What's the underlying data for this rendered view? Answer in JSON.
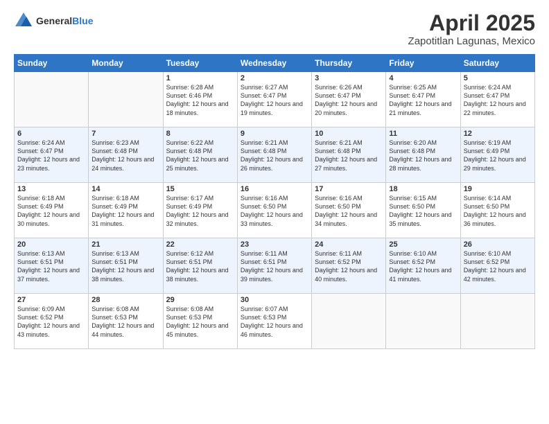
{
  "header": {
    "logo_line1": "General",
    "logo_line2": "Blue",
    "title": "April 2025",
    "subtitle": "Zapotitlan Lagunas, Mexico"
  },
  "days_of_week": [
    "Sunday",
    "Monday",
    "Tuesday",
    "Wednesday",
    "Thursday",
    "Friday",
    "Saturday"
  ],
  "weeks": [
    [
      {
        "day": "",
        "empty": true
      },
      {
        "day": "",
        "empty": true
      },
      {
        "day": "1",
        "sunrise": "Sunrise: 6:28 AM",
        "sunset": "Sunset: 6:46 PM",
        "daylight": "Daylight: 12 hours and 18 minutes."
      },
      {
        "day": "2",
        "sunrise": "Sunrise: 6:27 AM",
        "sunset": "Sunset: 6:47 PM",
        "daylight": "Daylight: 12 hours and 19 minutes."
      },
      {
        "day": "3",
        "sunrise": "Sunrise: 6:26 AM",
        "sunset": "Sunset: 6:47 PM",
        "daylight": "Daylight: 12 hours and 20 minutes."
      },
      {
        "day": "4",
        "sunrise": "Sunrise: 6:25 AM",
        "sunset": "Sunset: 6:47 PM",
        "daylight": "Daylight: 12 hours and 21 minutes."
      },
      {
        "day": "5",
        "sunrise": "Sunrise: 6:24 AM",
        "sunset": "Sunset: 6:47 PM",
        "daylight": "Daylight: 12 hours and 22 minutes."
      }
    ],
    [
      {
        "day": "6",
        "sunrise": "Sunrise: 6:24 AM",
        "sunset": "Sunset: 6:47 PM",
        "daylight": "Daylight: 12 hours and 23 minutes."
      },
      {
        "day": "7",
        "sunrise": "Sunrise: 6:23 AM",
        "sunset": "Sunset: 6:48 PM",
        "daylight": "Daylight: 12 hours and 24 minutes."
      },
      {
        "day": "8",
        "sunrise": "Sunrise: 6:22 AM",
        "sunset": "Sunset: 6:48 PM",
        "daylight": "Daylight: 12 hours and 25 minutes."
      },
      {
        "day": "9",
        "sunrise": "Sunrise: 6:21 AM",
        "sunset": "Sunset: 6:48 PM",
        "daylight": "Daylight: 12 hours and 26 minutes."
      },
      {
        "day": "10",
        "sunrise": "Sunrise: 6:21 AM",
        "sunset": "Sunset: 6:48 PM",
        "daylight": "Daylight: 12 hours and 27 minutes."
      },
      {
        "day": "11",
        "sunrise": "Sunrise: 6:20 AM",
        "sunset": "Sunset: 6:48 PM",
        "daylight": "Daylight: 12 hours and 28 minutes."
      },
      {
        "day": "12",
        "sunrise": "Sunrise: 6:19 AM",
        "sunset": "Sunset: 6:49 PM",
        "daylight": "Daylight: 12 hours and 29 minutes."
      }
    ],
    [
      {
        "day": "13",
        "sunrise": "Sunrise: 6:18 AM",
        "sunset": "Sunset: 6:49 PM",
        "daylight": "Daylight: 12 hours and 30 minutes."
      },
      {
        "day": "14",
        "sunrise": "Sunrise: 6:18 AM",
        "sunset": "Sunset: 6:49 PM",
        "daylight": "Daylight: 12 hours and 31 minutes."
      },
      {
        "day": "15",
        "sunrise": "Sunrise: 6:17 AM",
        "sunset": "Sunset: 6:49 PM",
        "daylight": "Daylight: 12 hours and 32 minutes."
      },
      {
        "day": "16",
        "sunrise": "Sunrise: 6:16 AM",
        "sunset": "Sunset: 6:50 PM",
        "daylight": "Daylight: 12 hours and 33 minutes."
      },
      {
        "day": "17",
        "sunrise": "Sunrise: 6:16 AM",
        "sunset": "Sunset: 6:50 PM",
        "daylight": "Daylight: 12 hours and 34 minutes."
      },
      {
        "day": "18",
        "sunrise": "Sunrise: 6:15 AM",
        "sunset": "Sunset: 6:50 PM",
        "daylight": "Daylight: 12 hours and 35 minutes."
      },
      {
        "day": "19",
        "sunrise": "Sunrise: 6:14 AM",
        "sunset": "Sunset: 6:50 PM",
        "daylight": "Daylight: 12 hours and 36 minutes."
      }
    ],
    [
      {
        "day": "20",
        "sunrise": "Sunrise: 6:13 AM",
        "sunset": "Sunset: 6:51 PM",
        "daylight": "Daylight: 12 hours and 37 minutes."
      },
      {
        "day": "21",
        "sunrise": "Sunrise: 6:13 AM",
        "sunset": "Sunset: 6:51 PM",
        "daylight": "Daylight: 12 hours and 38 minutes."
      },
      {
        "day": "22",
        "sunrise": "Sunrise: 6:12 AM",
        "sunset": "Sunset: 6:51 PM",
        "daylight": "Daylight: 12 hours and 38 minutes."
      },
      {
        "day": "23",
        "sunrise": "Sunrise: 6:11 AM",
        "sunset": "Sunset: 6:51 PM",
        "daylight": "Daylight: 12 hours and 39 minutes."
      },
      {
        "day": "24",
        "sunrise": "Sunrise: 6:11 AM",
        "sunset": "Sunset: 6:52 PM",
        "daylight": "Daylight: 12 hours and 40 minutes."
      },
      {
        "day": "25",
        "sunrise": "Sunrise: 6:10 AM",
        "sunset": "Sunset: 6:52 PM",
        "daylight": "Daylight: 12 hours and 41 minutes."
      },
      {
        "day": "26",
        "sunrise": "Sunrise: 6:10 AM",
        "sunset": "Sunset: 6:52 PM",
        "daylight": "Daylight: 12 hours and 42 minutes."
      }
    ],
    [
      {
        "day": "27",
        "sunrise": "Sunrise: 6:09 AM",
        "sunset": "Sunset: 6:52 PM",
        "daylight": "Daylight: 12 hours and 43 minutes."
      },
      {
        "day": "28",
        "sunrise": "Sunrise: 6:08 AM",
        "sunset": "Sunset: 6:53 PM",
        "daylight": "Daylight: 12 hours and 44 minutes."
      },
      {
        "day": "29",
        "sunrise": "Sunrise: 6:08 AM",
        "sunset": "Sunset: 6:53 PM",
        "daylight": "Daylight: 12 hours and 45 minutes."
      },
      {
        "day": "30",
        "sunrise": "Sunrise: 6:07 AM",
        "sunset": "Sunset: 6:53 PM",
        "daylight": "Daylight: 12 hours and 46 minutes."
      },
      {
        "day": "",
        "empty": true
      },
      {
        "day": "",
        "empty": true
      },
      {
        "day": "",
        "empty": true
      }
    ]
  ]
}
